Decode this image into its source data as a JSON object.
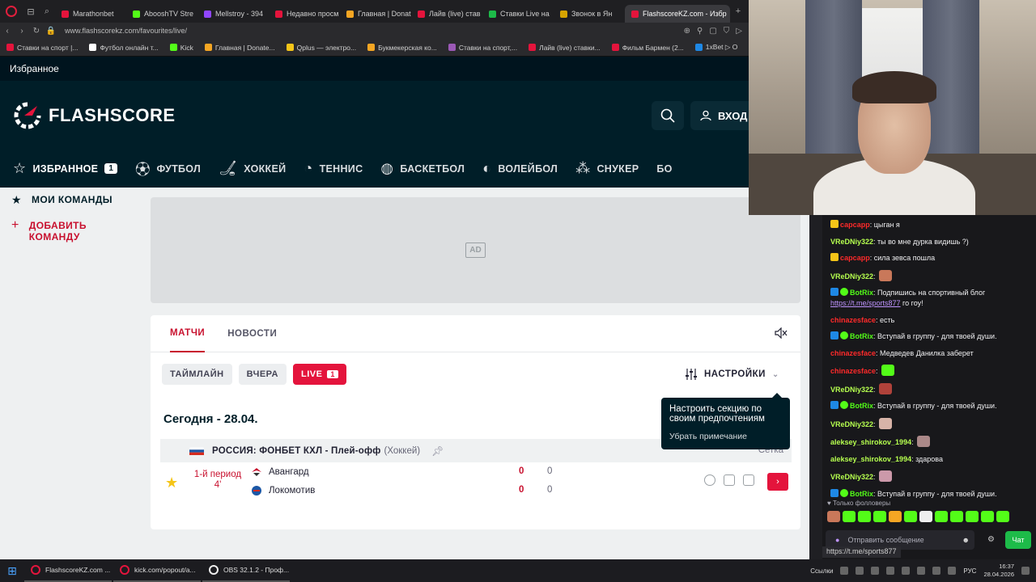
{
  "browser": {
    "tabs": [
      {
        "label": "Marathonbet",
        "color": "#e4143c"
      },
      {
        "label": "AbooshTV Stre",
        "color": "#53fc18"
      },
      {
        "label": "Mellstroy - 394",
        "color": "#9146ff"
      },
      {
        "label": "Недавно просм",
        "color": "#e4143c"
      },
      {
        "label": "Главная | Donat",
        "color": "#f5a623"
      },
      {
        "label": "Лайв (live) став",
        "color": "#e4143c"
      },
      {
        "label": "Ставки Live на",
        "color": "#1dbb49"
      },
      {
        "label": "Звонок в Ян",
        "color": "#d6a400"
      },
      {
        "label": "FlashscoreKZ.com - Избр",
        "color": "#e4143c"
      }
    ],
    "add_tab": "+",
    "url": "www.flashscorekz.com/favourites/live/",
    "bookmarks": [
      {
        "label": "Ставки на спорт |...",
        "color": "#e4143c"
      },
      {
        "label": "Футбол онлайн т...",
        "color": "#ffffff"
      },
      {
        "label": "Kick",
        "color": "#53fc18"
      },
      {
        "label": "Главная | Donate...",
        "color": "#f5a623"
      },
      {
        "label": "Qplus — электро...",
        "color": "#f5c518"
      },
      {
        "label": "Букмекерская ко...",
        "color": "#f5a623"
      },
      {
        "label": "Ставки на спорт,...",
        "color": "#9b59b6"
      },
      {
        "label": "Лайв (live) ставки...",
        "color": "#e4143c"
      },
      {
        "label": "Фильм Бармен (2...",
        "color": "#e4143c"
      },
      {
        "label": "1xBet ▷ О",
        "color": "#1e88e5"
      }
    ]
  },
  "site": {
    "favorites_bar": "Избранное",
    "logo": "FLASHSCORE",
    "login": "ВХОД",
    "nav": [
      {
        "label": "ИЗБРАННОЕ",
        "badge": "1",
        "icon": "star-icon"
      },
      {
        "label": "ФУТБОЛ",
        "icon": "football-icon"
      },
      {
        "label": "ХОККЕЙ",
        "icon": "hockey-icon"
      },
      {
        "label": "ТЕННИС",
        "icon": "tennis-icon"
      },
      {
        "label": "БАСКЕТБОЛ",
        "icon": "basketball-icon"
      },
      {
        "label": "ВОЛЕЙБОЛ",
        "icon": "volleyball-icon"
      },
      {
        "label": "СНУКЕР",
        "icon": "snooker-icon"
      },
      {
        "label": "БО",
        "icon": ""
      }
    ]
  },
  "sidebar": {
    "my_teams": "МОИ КОМАНДЫ",
    "add_team_line1": "ДОБАВИТЬ",
    "add_team_line2": "КОМАНДУ"
  },
  "ad": {
    "label": "AD"
  },
  "main": {
    "tabs": [
      "МАТЧИ",
      "НОВОСТИ"
    ],
    "filters": {
      "timeline": "ТАЙМЛАЙН",
      "yesterday": "ВЧЕРА",
      "live": "LIVE",
      "live_count": "1"
    },
    "settings": "НАСТРОЙКИ",
    "date": "Сегодня - 28.04.",
    "tooltip": {
      "title": "Настроить секцию по своим предпочтениям",
      "dismiss": "Убрать примечание"
    },
    "league": {
      "name": "РОССИЯ: ФОНБЕТ КХЛ - Плей-офф",
      "sport": "(Хоккей)",
      "draw": "Сетка"
    },
    "match": {
      "status": "1-й период",
      "minute": "4'",
      "home": {
        "name": "Авангард",
        "score": "0",
        "period": "0"
      },
      "away": {
        "name": "Локомотив",
        "score": "0",
        "period": "0"
      }
    }
  },
  "chat": {
    "messages": [
      {
        "user": "сарсарр",
        "color": "#ff2a2a",
        "text": ": цыган я",
        "badge": "crown"
      },
      {
        "user": "VReDNiy322",
        "color": "#b6ff4f",
        "text": ": ты во мне дурка видишь ?)",
        "badge": ""
      },
      {
        "user": "сарсарр",
        "color": "#ff2a2a",
        "text": ": сила зевса пошла",
        "badge": "crown"
      },
      {
        "user": "VReDNiy322",
        "color": "#b6ff4f",
        "text": ":",
        "badge": "",
        "emote": "#c9785a"
      },
      {
        "user": "BotRix",
        "color": "#53fc18",
        "text": ": Подпишись на спортивный блог",
        "link": "https://t.me/sports877",
        "after": " го гоу!",
        "badge": "bot"
      },
      {
        "user": "chinazesface",
        "color": "#ff2a2a",
        "text": ": есть",
        "badge": ""
      },
      {
        "user": "BotRix",
        "color": "#53fc18",
        "text": ": Вступай в группу - для твоей души.",
        "badge": "bot"
      },
      {
        "user": "chinazesface",
        "color": "#ff2a2a",
        "text": ": Медведев Данилка заберет",
        "badge": ""
      },
      {
        "user": "chinazesface",
        "color": "#ff2a2a",
        "text": ":",
        "badge": "",
        "emote": "#53fc18"
      },
      {
        "user": "VReDNiy322",
        "color": "#b6ff4f",
        "text": ":",
        "badge": "",
        "emote": "#b0423a"
      },
      {
        "user": "BotRix",
        "color": "#53fc18",
        "text": ": Вступай в группу - для твоей души.",
        "badge": "bot"
      },
      {
        "user": "VReDNiy322",
        "color": "#b6ff4f",
        "text": ":",
        "badge": "",
        "emote": "#d8b4a8"
      },
      {
        "user": "aleksey_shirokov_1994",
        "color": "#b6ff4f",
        "text": ":",
        "badge": "",
        "emote": "#a88"
      },
      {
        "user": "aleksey_shirokov_1994",
        "color": "#b6ff4f",
        "text": ": здарова",
        "badge": ""
      },
      {
        "user": "VReDNiy322",
        "color": "#b6ff4f",
        "text": ":",
        "badge": "",
        "emote": "#c9a"
      },
      {
        "user": "BotRix",
        "color": "#53fc18",
        "text": ": Вступай в группу - для твоей души.",
        "badge": "bot"
      }
    ],
    "followers_only": "Только фолловеры",
    "emotes": [
      "#c9785a",
      "#53fc18",
      "#53fc18",
      "#53fc18",
      "#f5a623",
      "#53fc18",
      "#eee",
      "#53fc18",
      "#53fc18",
      "#53fc18",
      "#53fc18",
      "#53fc18"
    ],
    "input_placeholder": "Отправить сообщение",
    "send": "Чат",
    "link_tooltip": "https://t.me/sports877"
  },
  "taskbar": {
    "tasks": [
      {
        "label": "FlashscoreKZ.com ...",
        "color": "#e4143c"
      },
      {
        "label": "kick.com/popout/a...",
        "color": "#e4143c"
      },
      {
        "label": "OBS 32.1.2 - Проф...",
        "color": "#eeeeee"
      }
    ],
    "links": "Ссылки",
    "lang": "РУС",
    "time": "16:37",
    "date": "28.04.2026"
  }
}
